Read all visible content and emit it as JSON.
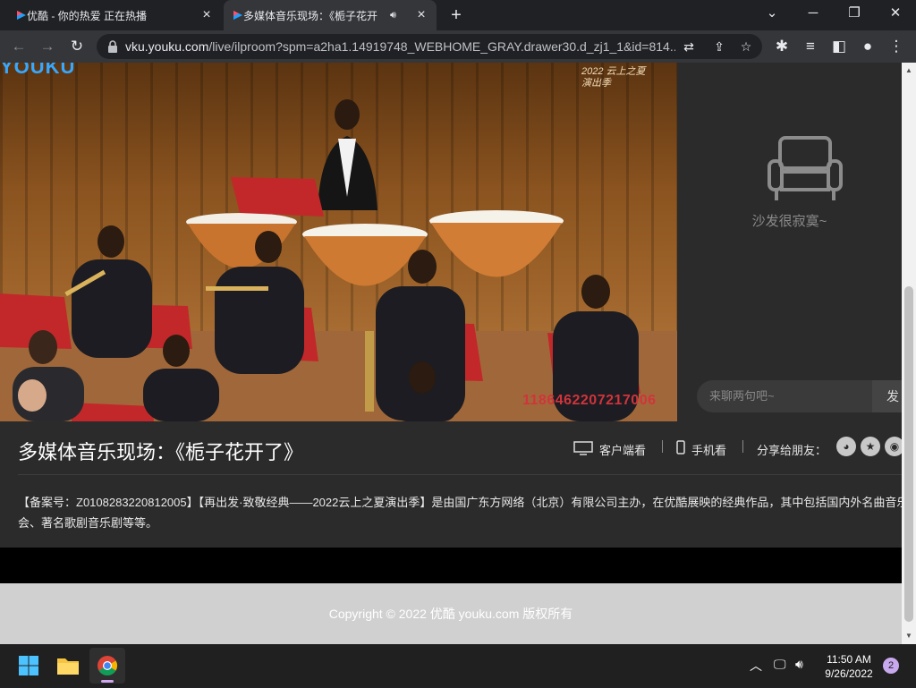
{
  "tabs": [
    {
      "title": "优酷 - 你的热爱 正在热播",
      "active": false
    },
    {
      "title": "多媒体音乐现场：《栀子花开",
      "active": true,
      "audio": "speaker-icon"
    }
  ],
  "toolbar": {
    "url_domain": "vku.youku.com",
    "url_path": "/live/ilproom?spm=a2ha1.14919748_WEBHOME_GRAY.drawer30.d_zj1_1&id=814..."
  },
  "video": {
    "logo": "YOUKU",
    "corner_text": "2022 云上之夏 演出季",
    "watermark": "1186462207217006"
  },
  "chat": {
    "empty_label": "沙发很寂寞~",
    "input_placeholder": "来聊两句吧~",
    "send_label": "发"
  },
  "info": {
    "title": "多媒体音乐现场：《栀子花开了》",
    "client_label": "客户端看",
    "mobile_label": "手机看",
    "share_label": "分享给朋友：",
    "description": "【备案号：Z0108283220812005】【再出发·致敬经典——2022云上之夏演出季】是由国广东方网络（北京）有限公司主办，在优酷展映的经典作品，其中包括国内外名曲音乐会、著名歌剧音乐剧等等。"
  },
  "footer": {
    "copyright": "Copyright © 2022 优酷 youku.com 版权所有"
  },
  "taskbar": {
    "time": "11:50 AM",
    "date": "9/26/2022",
    "notification_count": "2"
  },
  "colors": {
    "chrome_dark": "#202124",
    "chrome_toolbar": "#35363a",
    "page_panel": "#2b2b2b",
    "footer_bg": "#d0d0d0",
    "youku_blue": "#36a8ff"
  }
}
